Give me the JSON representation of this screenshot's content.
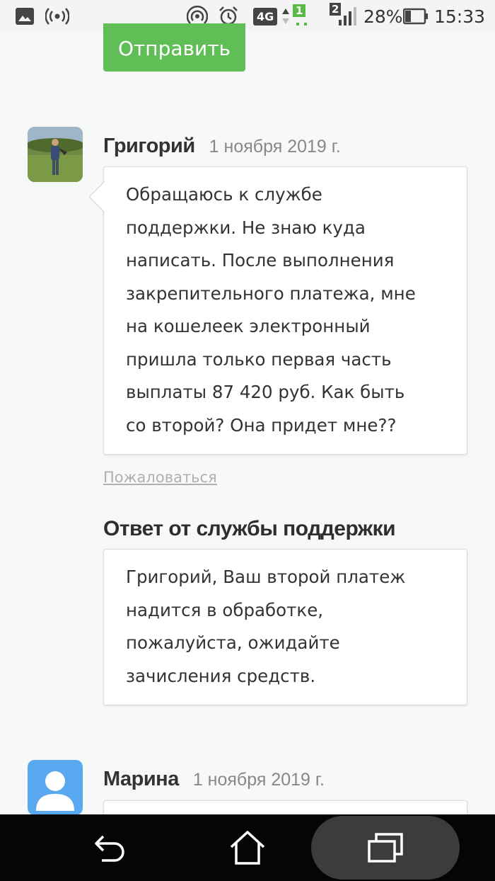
{
  "status_bar": {
    "network_type": "4G",
    "sim1_badge": "1",
    "sim2_badge": "2",
    "battery": "28%",
    "time": "15:33"
  },
  "form": {
    "submit_label": "Отправить"
  },
  "comments": [
    {
      "author": "Григорий",
      "date": "1 ноября 2019 г.",
      "text_lines": [
        "Обращаюсь к службе",
        "поддержки. Не знаю куда",
        "написать. После выполнения",
        "закрепительного платежа, мне",
        "на кошелеек электронный",
        "пришла только первая часть",
        "выплаты 87 420 руб. Как быть",
        "со второй? Она придет мне??"
      ],
      "report_label": "Пожаловаться",
      "reply": {
        "heading": "Ответ от службы поддержки",
        "text_lines": [
          "Григорий, Ваш второй платеж",
          "надится в обработке,",
          "пожалуйста, ожидайте",
          "зачисления средств."
        ]
      }
    },
    {
      "author": "Марина",
      "date": "1 ноября 2019 г."
    }
  ],
  "icons": {
    "status_left": [
      "image-icon",
      "broadcast-icon"
    ],
    "status_right": [
      "hotspot-icon",
      "alarm-icon",
      "network-type-icon",
      "signal-icon",
      "battery-icon"
    ],
    "nav": [
      "back-icon",
      "home-icon",
      "recents-icon"
    ]
  },
  "colors": {
    "accent_green": "#5fbe56",
    "avatar_placeholder_blue": "#5aa8f0",
    "nav_bar_bg": "#050505"
  }
}
